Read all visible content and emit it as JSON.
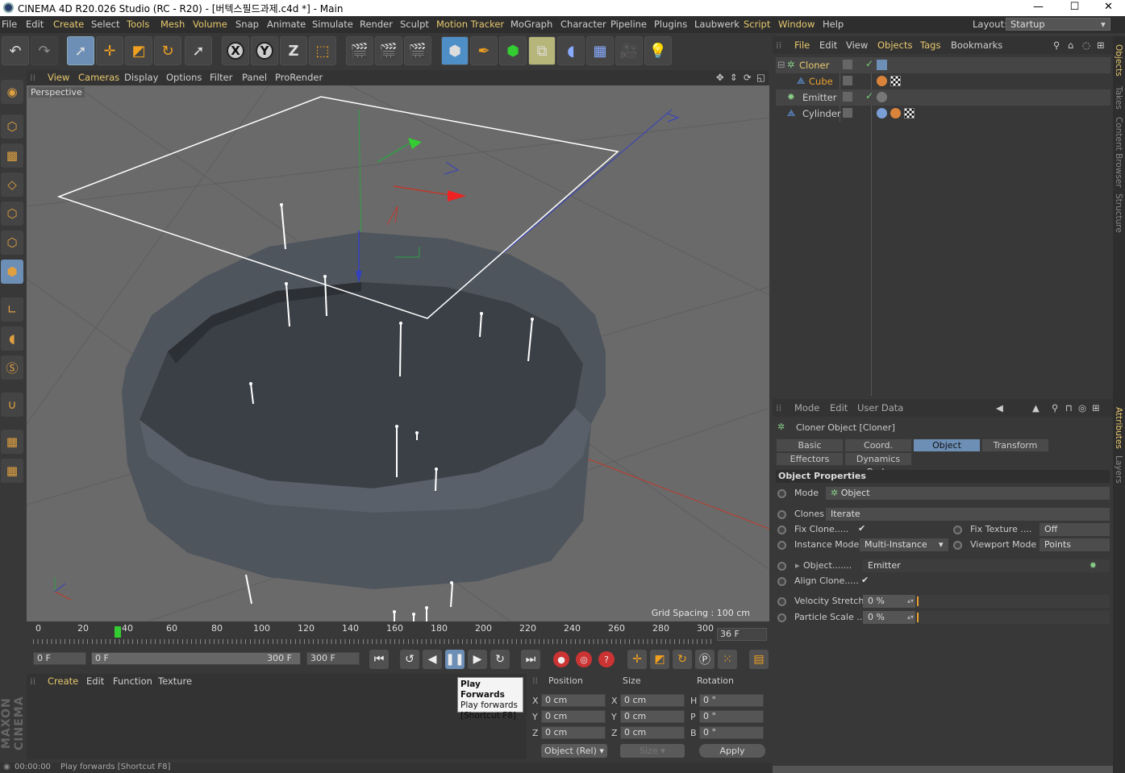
{
  "titlebar": {
    "title": "CINEMA 4D R20.026 Studio (RC - R20) - [버텍스필드과제.c4d *] - Main",
    "minimize": "—",
    "maximize": "☐",
    "close": "✕"
  },
  "menubar": {
    "items": [
      "File",
      "Edit",
      "Create",
      "Select",
      "Tools",
      "Mesh",
      "Volume",
      "Snap",
      "Animate",
      "Simulate",
      "Render",
      "Sculpt",
      "Motion Tracker",
      "MoGraph",
      "Character",
      "Pipeline",
      "Plugins",
      "Laubwerk",
      "Script",
      "Window",
      "Help"
    ],
    "layout_label": "Layout:",
    "layout_value": "Startup"
  },
  "viewport": {
    "menu": [
      "View",
      "Cameras",
      "Display",
      "Options",
      "Filter",
      "Panel",
      "ProRender"
    ],
    "label": "Perspective",
    "grid_spacing": "Grid Spacing : 100 cm"
  },
  "timeline": {
    "ticks": [
      "0",
      "20",
      "40",
      "60",
      "80",
      "100",
      "120",
      "140",
      "160",
      "180",
      "200",
      "220",
      "240",
      "260",
      "280",
      "300"
    ],
    "current_frame": "36 F",
    "start_field": "0 F",
    "range_start": "0 F",
    "range_end": "300 F",
    "end_field": "300 F"
  },
  "material_panel": {
    "menu": [
      "Create",
      "Edit",
      "Function",
      "Texture"
    ]
  },
  "tooltip": {
    "title": "Play Forwards",
    "line1": "Play forwards",
    "line2": "[Shortcut F8]"
  },
  "coord_panel": {
    "headers": [
      "Position",
      "Size",
      "Rotation"
    ],
    "rows": [
      {
        "axis": "X",
        "pos": "0 cm",
        "saxis": "X",
        "size": "0 cm",
        "raxis": "H",
        "rot": "0 °"
      },
      {
        "axis": "Y",
        "pos": "0 cm",
        "saxis": "Y",
        "size": "0 cm",
        "raxis": "P",
        "rot": "0 °"
      },
      {
        "axis": "Z",
        "pos": "0 cm",
        "saxis": "Z",
        "size": "0 cm",
        "raxis": "B",
        "rot": "0 °"
      }
    ],
    "mode": "Object (Rel)",
    "size_mode": "Size",
    "apply": "Apply"
  },
  "statusbar": {
    "time": "00:00:00",
    "message": "Play forwards [Shortcut F8]"
  },
  "object_manager": {
    "menu": [
      "File",
      "Edit",
      "View",
      "Objects",
      "Tags",
      "Bookmarks"
    ],
    "objects": [
      {
        "name": "Cloner",
        "color": "#e8c96e",
        "indent": 0
      },
      {
        "name": "Cube",
        "color": "#e8a030",
        "indent": 1
      },
      {
        "name": "Emitter",
        "color": "#cfcfcf",
        "indent": 0
      },
      {
        "name": "Cylinder",
        "color": "#cfcfcf",
        "indent": 0
      }
    ]
  },
  "attributes": {
    "menu": [
      "Mode",
      "Edit",
      "User Data"
    ],
    "header": "Cloner Object [Cloner]",
    "tabs_row1": [
      "Basic",
      "Coord.",
      "Object",
      "Transform"
    ],
    "tabs_row2": [
      "Effectors",
      "Dynamics Body"
    ],
    "active_tab": "Object",
    "section": "Object Properties",
    "mode_label": "Mode",
    "mode_value": "Object",
    "clones_label": "Clones",
    "clones_value": "Iterate",
    "fix_clone_label": "Fix Clone.....",
    "fix_texture_label": "Fix Texture ....",
    "fix_texture_value": "Off",
    "instance_mode_label": "Instance Mode",
    "instance_mode_value": "Multi-Instance",
    "viewport_mode_label": "Viewport Mode",
    "viewport_mode_value": "Points",
    "object_label": "Object.......",
    "object_value": "Emitter",
    "align_clone_label": "Align Clone.....",
    "velocity_label": "Velocity Stretch",
    "velocity_value": "0 %",
    "particle_label": "Particle Scale ..",
    "particle_value": "0 %"
  },
  "side_tabs": [
    "Objects",
    "Takes",
    "Content Browser",
    "Structure",
    "Attributes",
    "Layers"
  ],
  "maxon_logo": "MAXON CINEMA 4D"
}
